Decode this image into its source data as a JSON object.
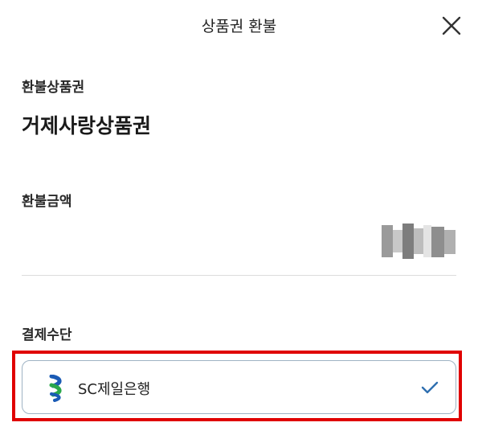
{
  "header": {
    "title": "상품권 환불",
    "close_icon": "close-icon"
  },
  "voucher": {
    "label": "환불상품권",
    "name": "거제사랑상품권"
  },
  "amount": {
    "label": "환불금액",
    "value_note": "masked"
  },
  "payment": {
    "label": "결제수단",
    "bank_name": "SC제일은행",
    "bank_icon": "sc-bank-logo-icon",
    "selected_icon": "check-icon",
    "selected": true
  },
  "colors": {
    "highlight": "#e00000",
    "card_border": "#9fb3c4",
    "check": "#2f6fb0",
    "logo_blue": "#1a5bb5",
    "logo_green": "#2aa84a"
  }
}
